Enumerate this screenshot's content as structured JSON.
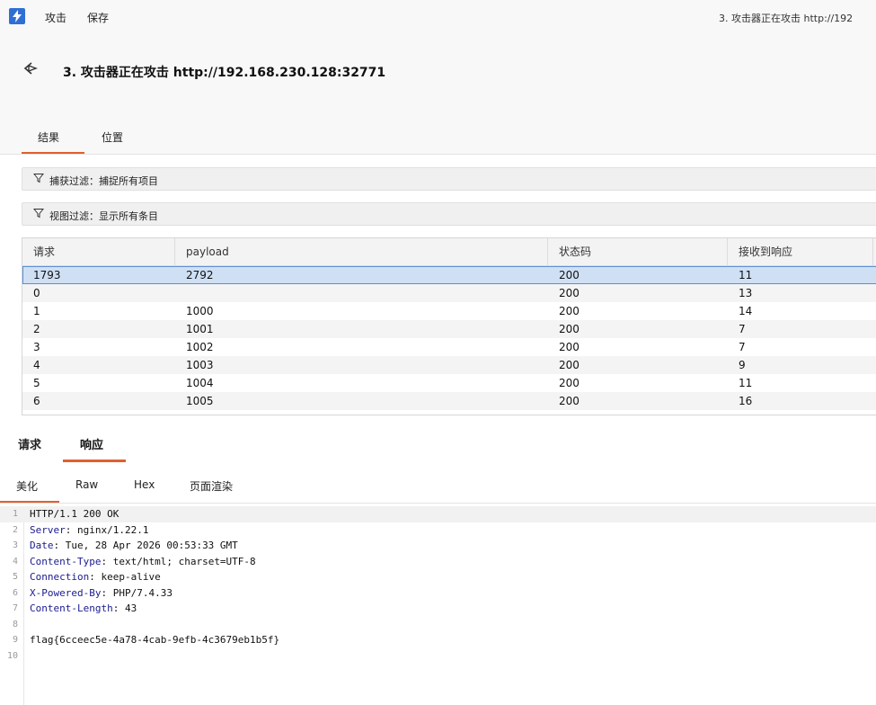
{
  "menubar": {
    "logo_icon": "burp-lightning-icon",
    "attack_label": "攻击",
    "save_label": "保存",
    "window_title": "3. 攻击器正在攻击 http://192"
  },
  "header": {
    "back_icon": "back-arrow-icon",
    "title": "3. 攻击器正在攻击 http://192.168.230.128:32771",
    "tabs": [
      {
        "label": "结果"
      },
      {
        "label": "位置"
      }
    ]
  },
  "filters": {
    "capture": "捕获过滤：捕捉所有项目",
    "view": "视图过滤：显示所有条目"
  },
  "table": {
    "headers": [
      "请求",
      "payload",
      "状态码",
      "接收到响应"
    ],
    "rows": [
      [
        "1793",
        "2792",
        "200",
        "11"
      ],
      [
        "0",
        "",
        "200",
        "13"
      ],
      [
        "1",
        "1000",
        "200",
        "14"
      ],
      [
        "2",
        "1001",
        "200",
        "7"
      ],
      [
        "3",
        "1002",
        "200",
        "7"
      ],
      [
        "4",
        "1003",
        "200",
        "9"
      ],
      [
        "5",
        "1004",
        "200",
        "11"
      ],
      [
        "6",
        "1005",
        "200",
        "16"
      ]
    ]
  },
  "rr_tabs": {
    "request": "请求",
    "response": "响应"
  },
  "view_tabs": {
    "pretty": "美化",
    "raw": "Raw",
    "hex": "Hex",
    "render": "页面渲染"
  },
  "response": {
    "lines": [
      {
        "key": "",
        "value": "HTTP/1.1 200 OK"
      },
      {
        "key": "Server",
        "value": ": nginx/1.22.1"
      },
      {
        "key": "Date",
        "value": ": Tue, 28 Apr 2026 00:53:33 GMT"
      },
      {
        "key": "Content-Type",
        "value": ": text/html; charset=UTF-8"
      },
      {
        "key": "Connection",
        "value": ": keep-alive"
      },
      {
        "key": "X-Powered-By",
        "value": ": PHP/7.4.33"
      },
      {
        "key": "Content-Length",
        "value": ": 43"
      },
      {
        "key": "",
        "value": ""
      },
      {
        "key": "",
        "value": "flag{6cceec5e-4a78-4cab-9efb-4c3679eb1b5f}"
      },
      {
        "key": "",
        "value": ""
      }
    ]
  },
  "colors": {
    "accent": "#e0602e",
    "selection": "#cfe0f5",
    "brand": "#2f6fd4"
  }
}
